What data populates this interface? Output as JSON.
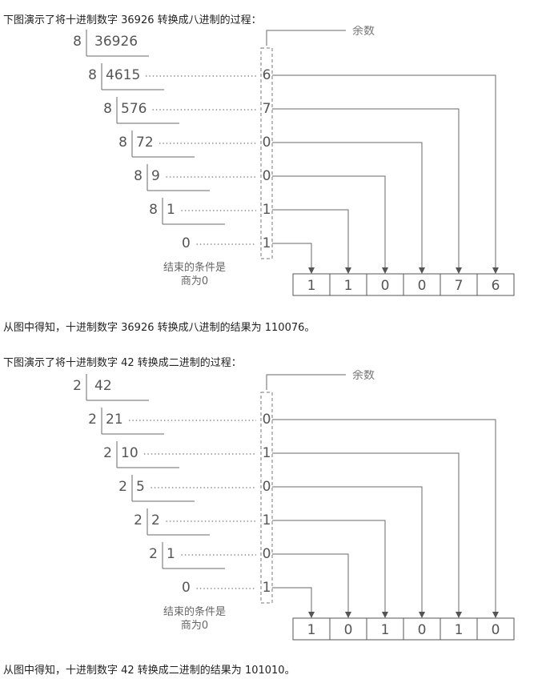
{
  "sections": [
    {
      "intro": "下图演示了将十进制数字 36926 转换成八进制的过程：",
      "conclusion": "从图中得知，十进制数字 36926 转换成八进制的结果为 110076。",
      "diagram": {
        "divisor": "8",
        "quotients": [
          "36926",
          "4615",
          "576",
          "72",
          "9",
          "1",
          "0"
        ],
        "remainders": [
          "6",
          "7",
          "0",
          "0",
          "1",
          "1"
        ],
        "remainder_label": "余数",
        "end_note": [
          "结束的条件是",
          "商为0"
        ],
        "result": [
          "1",
          "1",
          "0",
          "0",
          "7",
          "6"
        ]
      }
    },
    {
      "intro": "下图演示了将十进制数字 42 转换成二进制的过程：",
      "conclusion": "从图中得知，十进制数字 42 转换成二进制的结果为 101010。",
      "diagram": {
        "divisor": "2",
        "quotients": [
          "42",
          "21",
          "10",
          "5",
          "2",
          "1",
          "0"
        ],
        "remainders": [
          "0",
          "1",
          "0",
          "1",
          "0",
          "1"
        ],
        "remainder_label": "余数",
        "end_note": [
          "结束的条件是",
          "商为0"
        ],
        "result": [
          "1",
          "0",
          "1",
          "0",
          "1",
          "0"
        ]
      }
    }
  ]
}
